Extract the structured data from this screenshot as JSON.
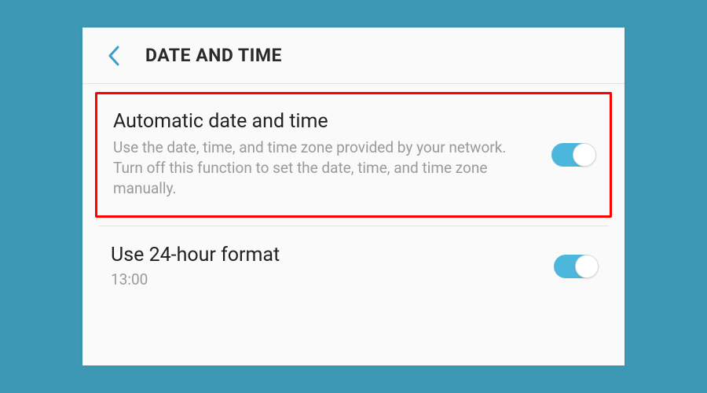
{
  "header": {
    "title": "DATE AND TIME"
  },
  "settings": {
    "auto_datetime": {
      "title": "Automatic date and time",
      "description": "Use the date, time, and time zone provided by your network. Turn off this function to set the date, time, and time zone manually.",
      "enabled": true
    },
    "hour_format_24": {
      "title": "Use 24-hour format",
      "example": "13:00",
      "enabled": true
    }
  },
  "colors": {
    "background": "#3c98b4",
    "toggle_on": "#4cb7dd",
    "highlight": "#ff0000"
  }
}
